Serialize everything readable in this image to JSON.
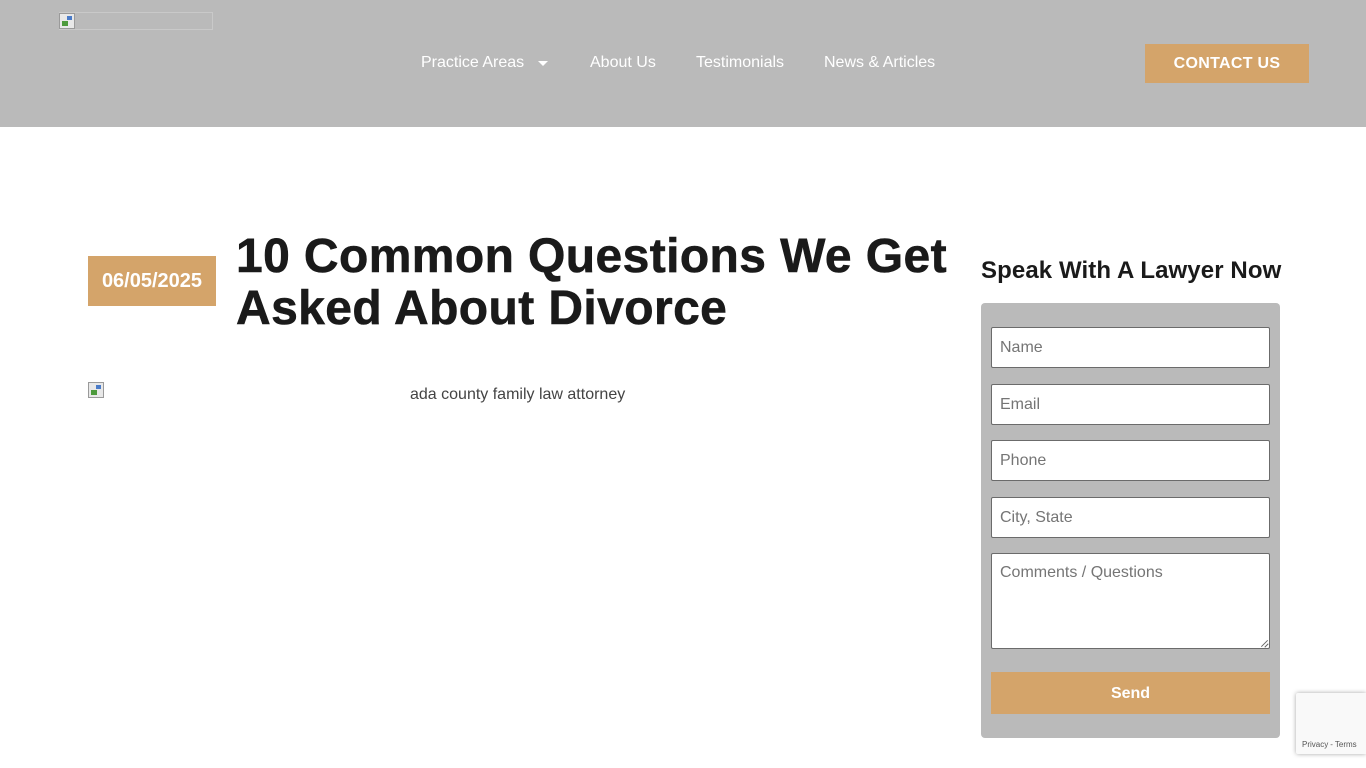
{
  "header": {
    "logo_icon": "broken-image-icon",
    "nav": {
      "practice_areas": "Practice Areas",
      "practice_areas_icon": "chevron-down-icon",
      "about_us": "About Us",
      "testimonials": "Testimonials",
      "news_articles": "News & Articles"
    },
    "contact_button": "CONTACT US"
  },
  "article": {
    "date": "06/05/2025",
    "title": "10 Common Questions We Get Asked About Divorce",
    "image_alt": "ada county family law attorney",
    "image_icon": "broken-image-icon"
  },
  "sidebar": {
    "title": "Speak With A Lawyer Now",
    "form": {
      "name_placeholder": "Name",
      "email_placeholder": "Email",
      "phone_placeholder": "Phone",
      "city_placeholder": "City, State",
      "comments_placeholder": "Comments / Questions",
      "send_label": "Send"
    }
  },
  "recaptcha": {
    "privacy": "Privacy",
    "separator": "-",
    "terms": "Terms"
  },
  "colors": {
    "header_bg": "#bababa",
    "accent": "#d4a46a",
    "title_text": "#1a1a1a",
    "white": "#ffffff"
  }
}
